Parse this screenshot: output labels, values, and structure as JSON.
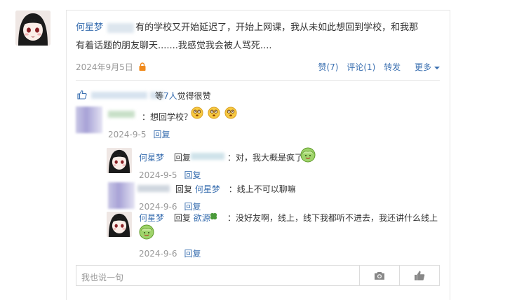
{
  "post": {
    "author": "何星梦",
    "text_part1": "有的学校又开始延迟了，开始上网课，我从未如此想回到学校，和我那",
    "text_part2": "有着话题的朋友聊天.......我感觉我会被人骂死....",
    "date": "2024年9月5日",
    "actions": {
      "like": "赞(7)",
      "comment": "评论(1)",
      "repost": "转发",
      "more": "更多"
    }
  },
  "likes": {
    "suffix_pre": "等",
    "count": "7人",
    "suffix_post": "觉得很赞"
  },
  "comments": [
    {
      "text": "：想回学校？",
      "date": "2024-9-5",
      "reply": "回复"
    },
    {
      "author": "何星梦",
      "reply_word": "回复",
      "text": "：对，我大概是疯了",
      "date": "2024-9-5",
      "reply": "回复"
    },
    {
      "reply_word": "回复",
      "target": "何星梦",
      "text": "：线上不可以聊嘛",
      "date": "2024-9-6",
      "reply": "回复"
    },
    {
      "author": "何星梦",
      "reply_word": "回复",
      "target": "欲源",
      "text": "：没好友啊，线上，线下我都听不进去，我还讲什么线上",
      "date": "2024-9-6",
      "reply": "回复"
    }
  ],
  "input": {
    "placeholder": "我也说一句"
  },
  "colors": {
    "link": "#3a6fb0",
    "meta": "#999999",
    "lock": "#f08a1c"
  }
}
